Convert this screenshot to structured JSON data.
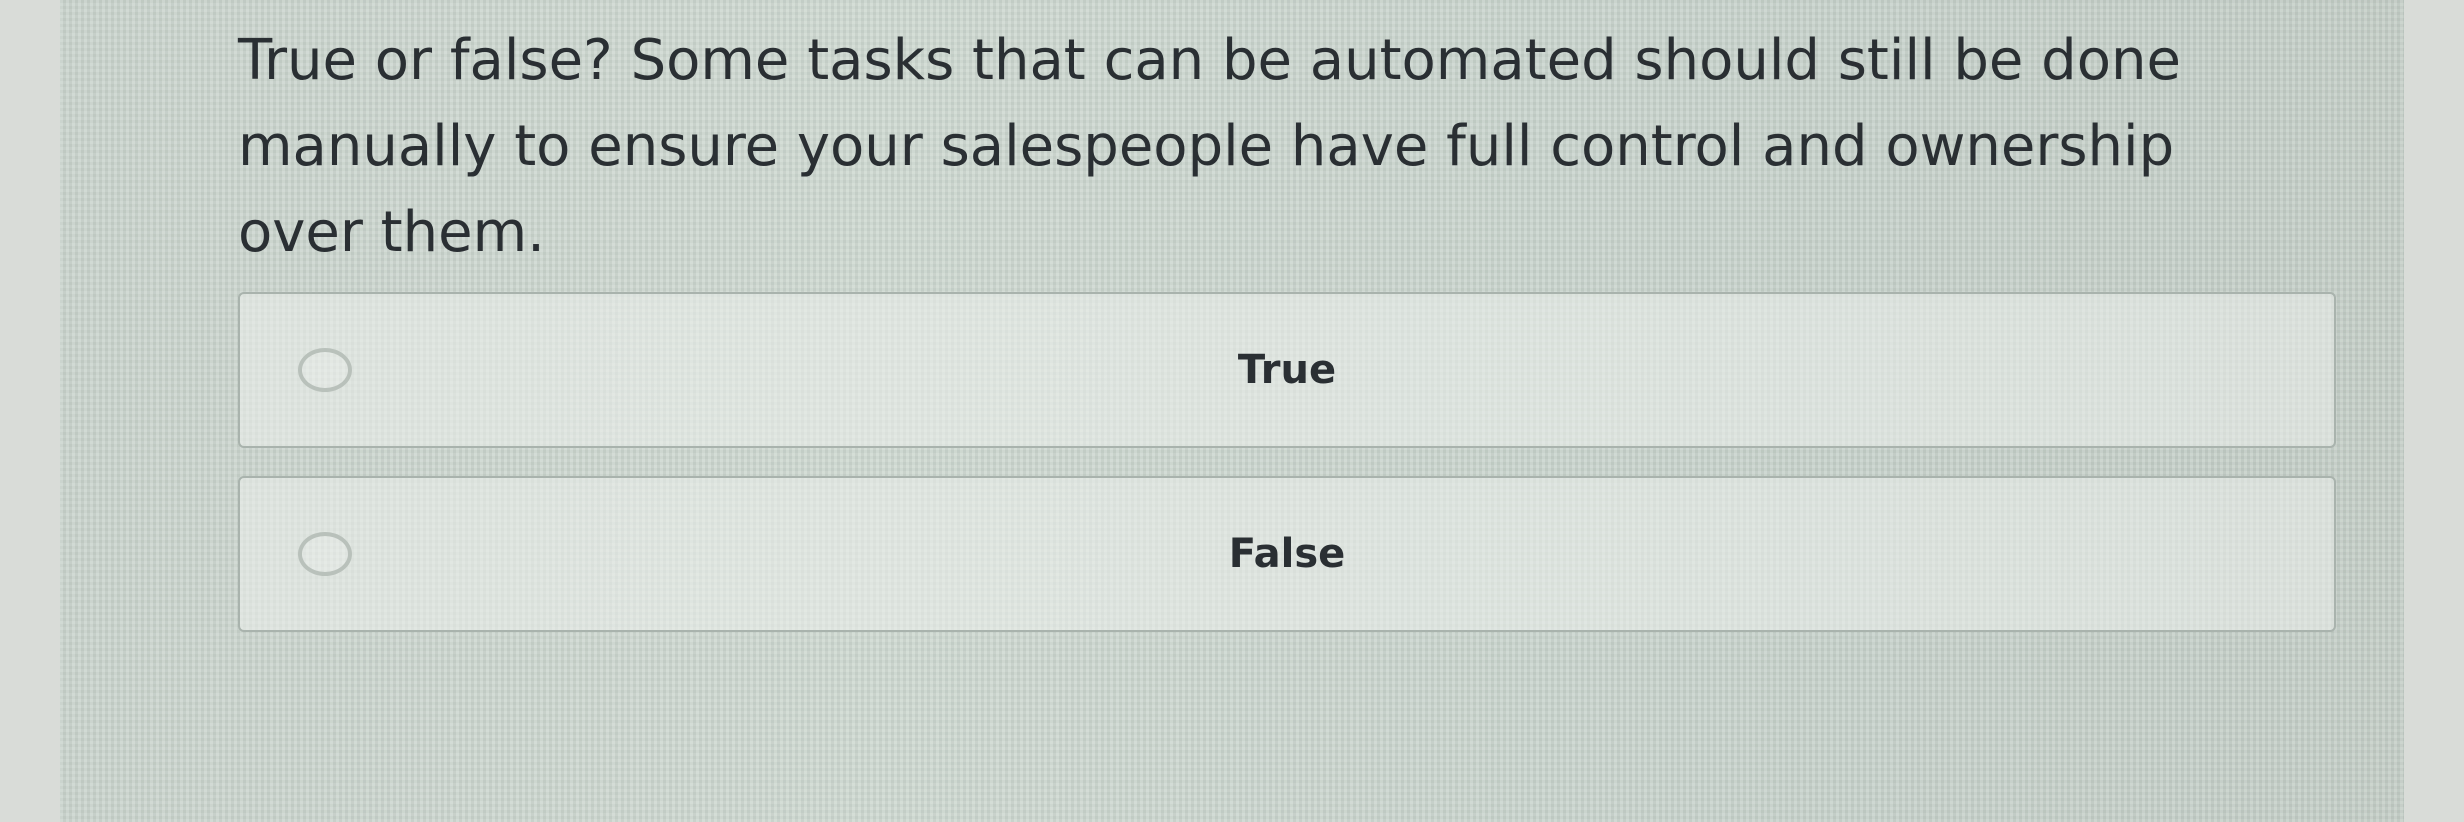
{
  "question": {
    "text": "True or false? Some tasks that can be automated should still be done manually to ensure your salespeople have full control and ownership over them."
  },
  "options": [
    {
      "label": "True",
      "selected": false
    },
    {
      "label": "False",
      "selected": false
    }
  ]
}
